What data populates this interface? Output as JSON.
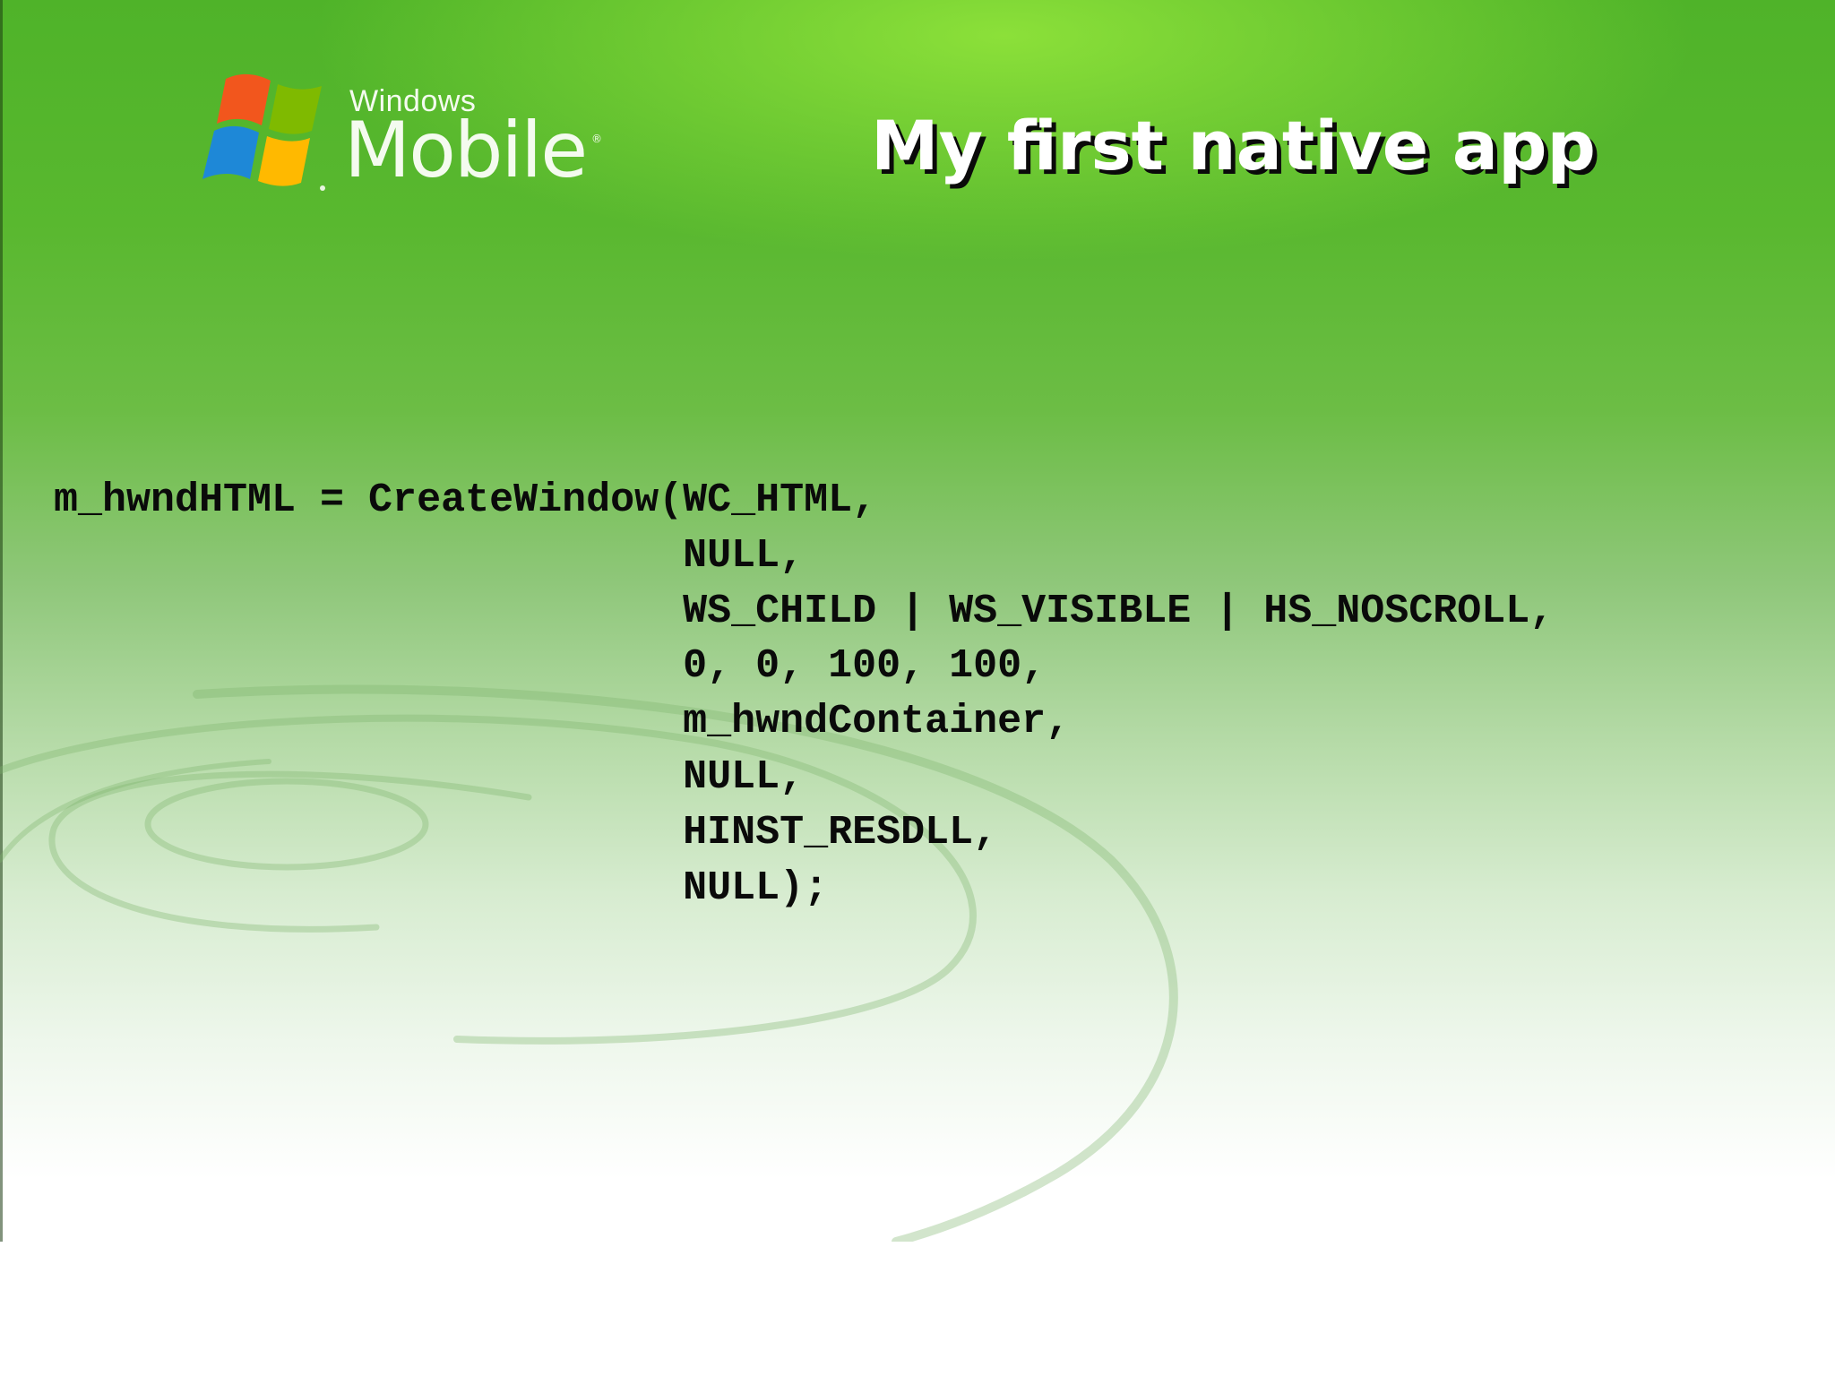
{
  "slide": {
    "title": "My first native app",
    "logo": {
      "small_word": "Windows",
      "big_word": "Mobile",
      "reg_mark": "®",
      "icon": "windows-flag-icon"
    },
    "code_lines": [
      "m_hwndHTML = CreateWindow(WC_HTML,",
      "                          NULL,",
      "                          WS_CHILD | WS_VISIBLE | HS_NOSCROLL,",
      "                          0, 0, 100, 100,",
      "                          m_hwndContainer,",
      "                          NULL,",
      "                          HINST_RESDLL,",
      "                          NULL);"
    ]
  },
  "colors": {
    "background_top": "#4fb329",
    "background_bottom": "#ffffff",
    "title_text": "#ffffff",
    "title_shadow": "#0a0a0a",
    "code_text": "#0a0a0a"
  }
}
